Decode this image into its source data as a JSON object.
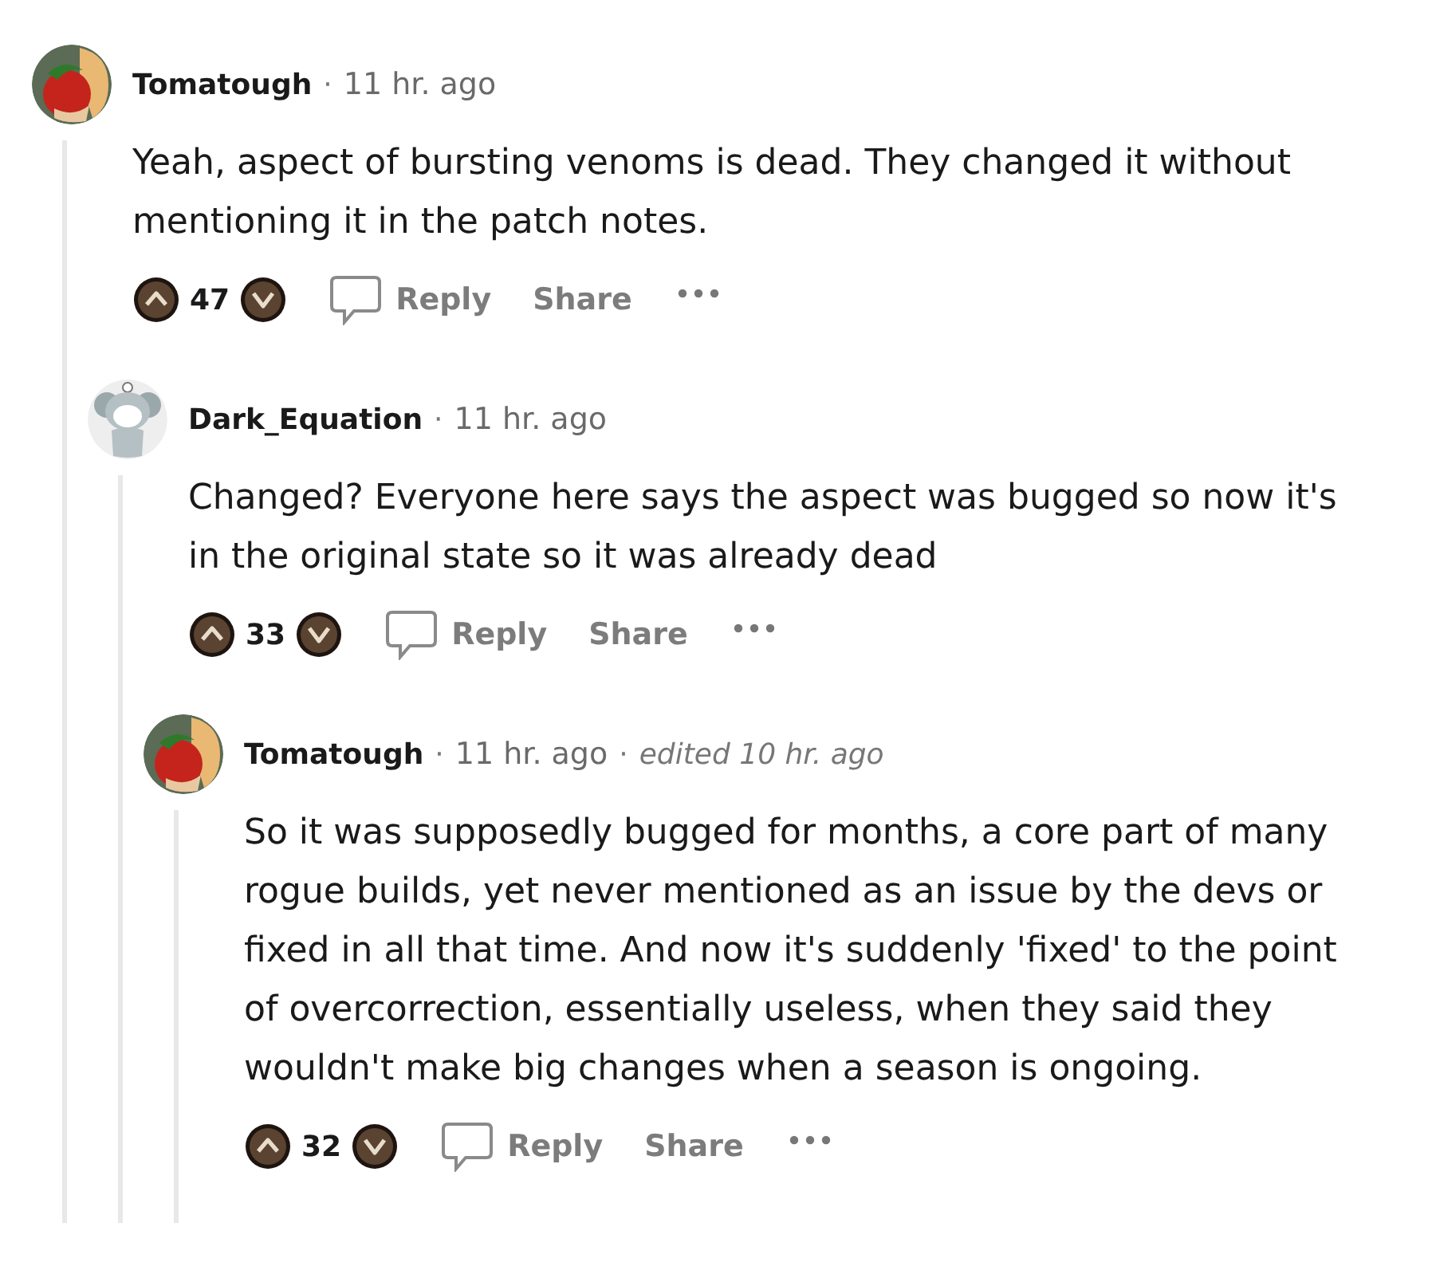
{
  "comments": [
    {
      "author": "Tomatough",
      "avatar": {
        "kind": "tomato"
      },
      "separators": [
        "·"
      ],
      "time": "11 hr. ago",
      "body": "Yeah, aspect of bursting venoms is dead. They changed it without mentioning it in the patch notes.",
      "score": "47",
      "actions": [
        "Reply",
        "Share"
      ],
      "children": [
        {
          "author": "Dark_Equation",
          "avatar": {
            "kind": "koala"
          },
          "separators": [
            "·"
          ],
          "time": "11 hr. ago",
          "body": "Changed? Everyone here says the aspect was bugged so now it's in the original state so it was already dead",
          "score": "33",
          "actions": [
            "Reply",
            "Share"
          ],
          "children": [
            {
              "author": "Tomatough",
              "avatar": {
                "kind": "tomato"
              },
              "separators": [
                "·",
                "·"
              ],
              "time": "11 hr. ago",
              "edited": "edited 10 hr. ago",
              "body": "So it was supposedly bugged for months, a core part of many rogue builds, yet never mentioned as an issue by the devs or fixed in all that time. And now it's suddenly 'fixed' to the point of overcorrection, essentially useless, when they said they wouldn't make big changes when a season is ongoing.",
              "score": "32",
              "actions": [
                "Reply",
                "Share"
              ]
            }
          ]
        }
      ]
    }
  ]
}
